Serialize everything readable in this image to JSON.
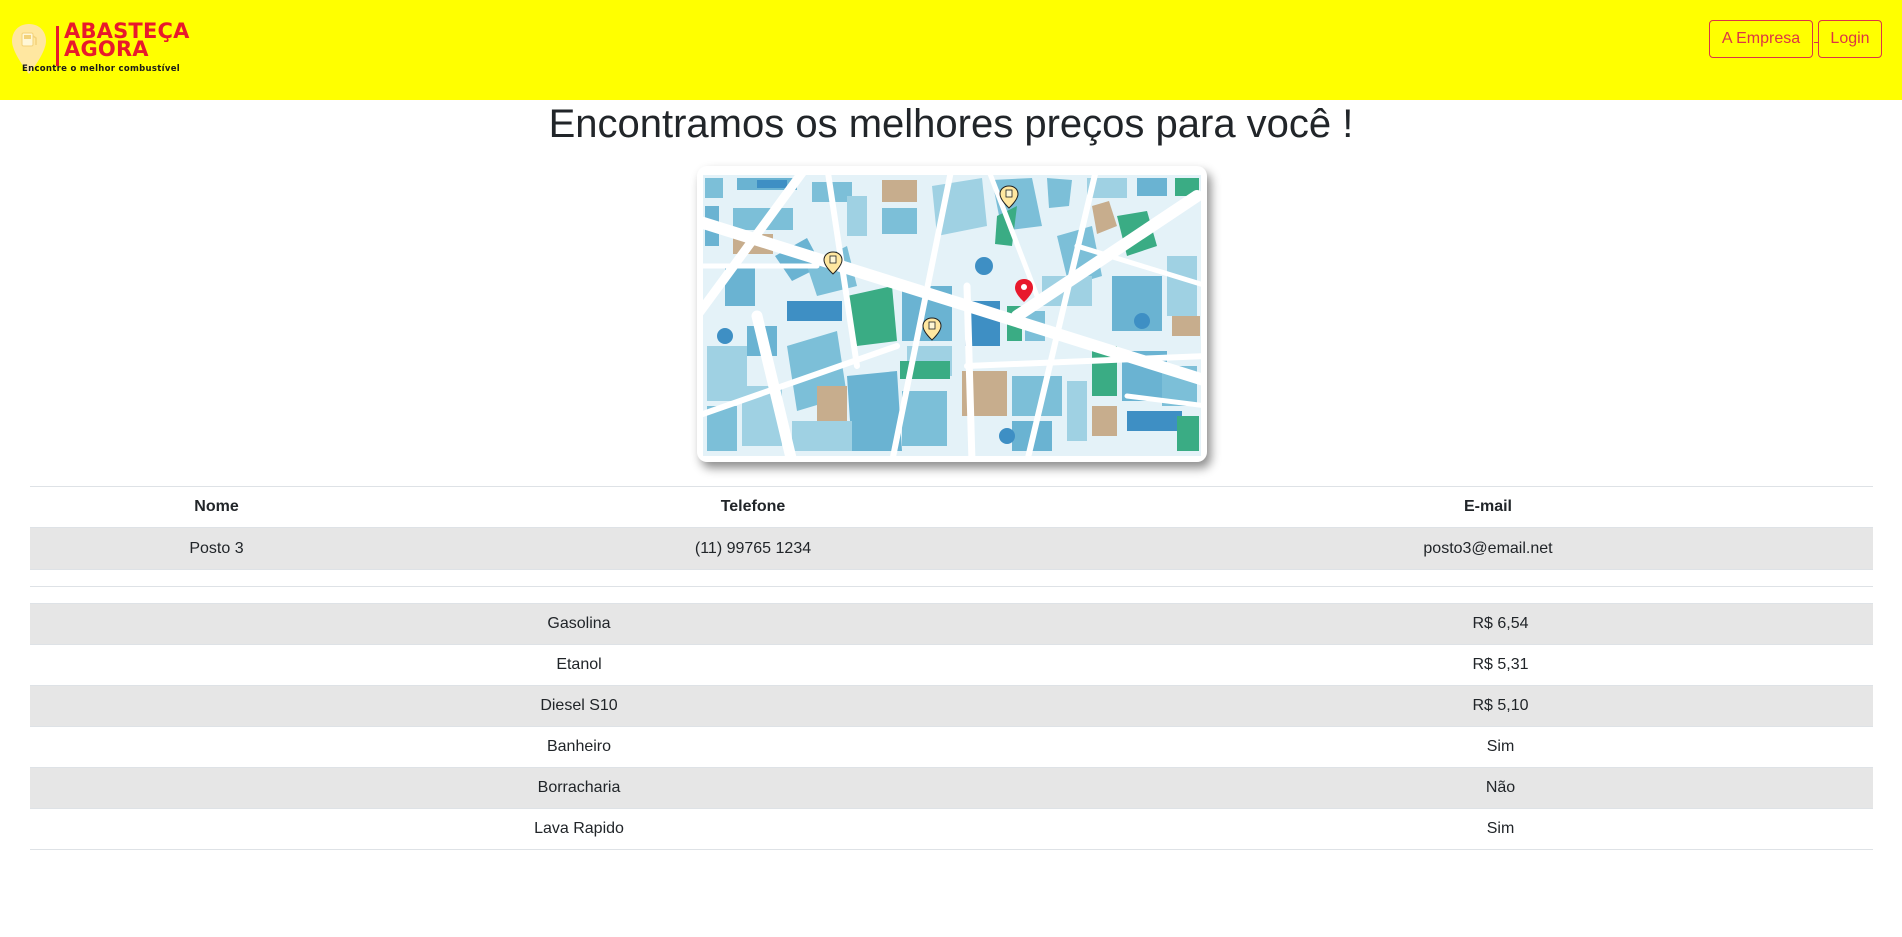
{
  "brand": {
    "name_line1": "ABASTEÇA",
    "name_line2": "AGORA",
    "tagline": "Encontre o melhor combustível",
    "color": "#e8192c",
    "icon": "fuel-pin-icon"
  },
  "nav": {
    "company_label": "A Empresa",
    "login_label": "Login"
  },
  "page": {
    "heading": "Encontramos os melhores preços para você !",
    "map_image": "city-map-illustration"
  },
  "station_table": {
    "headers": [
      "Nome",
      "Telefone",
      "E-mail"
    ],
    "rows": [
      {
        "name": "Posto 3",
        "phone": "(11) 99765 1234",
        "email": "posto3@email.net"
      }
    ]
  },
  "prices_table": {
    "rows": [
      {
        "item": "Gasolina",
        "value": "R$ 6,54"
      },
      {
        "item": "Etanol",
        "value": "R$ 5,31"
      },
      {
        "item": "Diesel S10",
        "value": "R$ 5,10"
      },
      {
        "item": "Banheiro",
        "value": "Sim"
      },
      {
        "item": "Borracharia",
        "value": "Não"
      },
      {
        "item": "Lava Rapido",
        "value": "Sim"
      }
    ]
  },
  "colors": {
    "navbar_bg": "#ffff00",
    "button_outline": "#dc3545",
    "stripe": "#e6e6e6"
  }
}
